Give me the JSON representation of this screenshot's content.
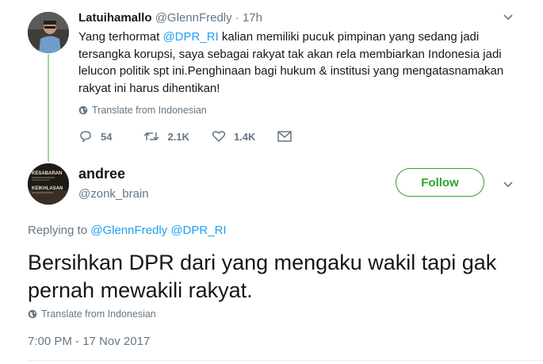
{
  "reply_tweet": {
    "author_name": "Latuihamallo",
    "author_handle": "@GlennFredly",
    "time_ago": "17h",
    "text_before": "Yang terhormat ",
    "mention": "@DPR_RI",
    "text_after": " kalian memiliki pucuk pimpinan yang sedang jadi tersangka korupsi, saya sebagai rakyat tak akan rela membiarkan Indonesia jadi lelucon politik spt ini.Penghinaan bagi hukum & institusi yang mengatasnamakan rakyat ini harus dihentikan!",
    "separator": " · ",
    "translate_label": "Translate from Indonesian",
    "reply_count": "54",
    "retweet_count": "2.1K",
    "like_count": "1.4K"
  },
  "main_tweet": {
    "author_name": "andree",
    "author_handle": "@zonk_brain",
    "follow_label": "Follow",
    "replying_prefix": "Replying to",
    "replying_to_1": "@GlennFredly",
    "replying_to_2": "@DPR_RI",
    "text": "Bersihkan DPR dari yang mengaku wakil tapi gak pernah mewakili rakyat.",
    "translate_label": "Translate from Indonesian",
    "timestamp": "7:00 PM - 17 Nov 2017",
    "avatar_text": [
      "KESABARAN",
      "KEIKHLASAN"
    ]
  },
  "colors": {
    "accent": "#1da1f2",
    "follow_green": "#2aa52a",
    "thread_line": "#9adb9a",
    "muted": "#657786"
  }
}
